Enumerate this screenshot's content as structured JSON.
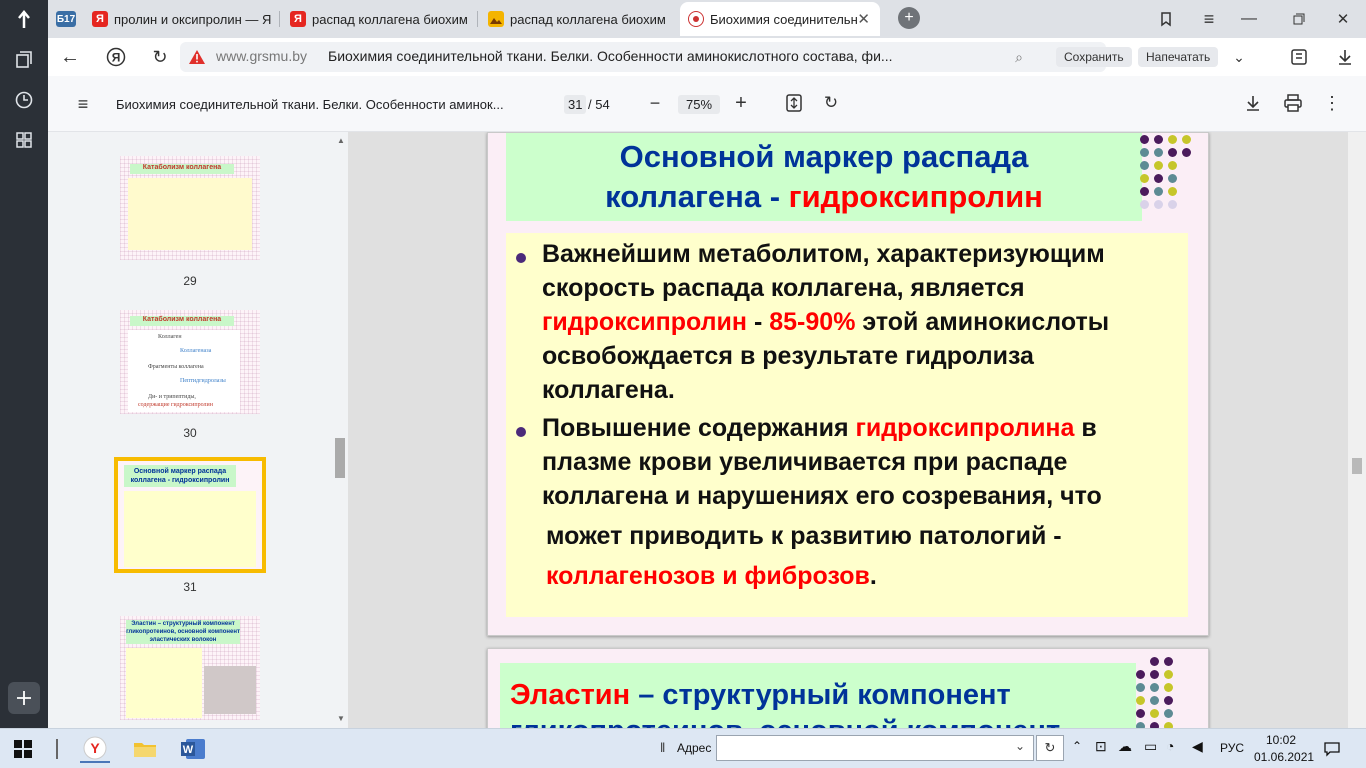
{
  "tabs": [
    {
      "label": "Б17",
      "kind": "pinned"
    },
    {
      "label": "пролин и оксипролин — Я",
      "icon": "yandex-icon"
    },
    {
      "label": "распад коллагена биохим",
      "icon": "yandex-icon"
    },
    {
      "label": "распад коллагена биохим",
      "icon": "image-icon"
    },
    {
      "label": "Биохимия соединительн",
      "icon": "site-icon",
      "active": true
    }
  ],
  "address": {
    "domain": "www.grsmu.by",
    "page_title": "Биохимия соединительной ткани. Белки. Особенности аминокислотного состава, фи...",
    "save_label": "Сохранить",
    "print_label": "Напечатать"
  },
  "pdf": {
    "doc_title": "Биохимия соединительной ткани. Белки. Особенности аминок...",
    "page_current": "31",
    "page_total": "/ 54",
    "zoom": "75%"
  },
  "thumbnails": [
    {
      "num": "29",
      "title": "Катаболизм коллагена"
    },
    {
      "num": "30",
      "title": "Катаболизм коллагена",
      "l1": "Коллаген",
      "l2": "Коллагеназа",
      "l3": "Фрагменты коллагена",
      "l4": "Пептидгидролазы",
      "l5": "Ди- и трипептиды,",
      "l6": "содержащие гидроксипролин"
    },
    {
      "num": "31",
      "title": "Основной маркер распада коллагена - гидроксипролин",
      "selected": true
    },
    {
      "num": "",
      "title": "Эластин – структурный компонент гликопротеинов, основной компонент эластических волокон"
    }
  ],
  "slide31": {
    "title_1": "Основной маркер распада",
    "title_2a": "коллагена - ",
    "title_2b": "гидроксипролин",
    "b1_l1": "Важнейшим метаболитом, характеризующим",
    "b1_l2": "скорость распада коллагена, является",
    "b1_l3a": "гидроксипролин",
    "b1_l3b": " - ",
    "b1_l3c": "85-90%",
    "b1_l3d": " этой аминокислоты",
    "b1_l4": "освобождается в результате гидролиза",
    "b1_l5": "коллагена.",
    "b2_l1a": "Повышение содержания ",
    "b2_l1b": "гидроксипролина",
    "b2_l1c": " в",
    "b2_l2": "плазме крови увеличивается при распаде",
    "b2_l3": "коллагена и нарушениях его созревания, что",
    "b2_l4": "может приводить к развитию патологий -",
    "b2_l5a": "коллагенозов и фиброзов",
    "b2_l5b": "."
  },
  "slide32": {
    "title_a": "Эластин",
    "title_b": " – структурный компонент",
    "title_c": "гликопротеинов, основной компонент"
  },
  "taskbar": {
    "address_label": "Адрес",
    "lang": "РУС",
    "time": "10:02",
    "date": "01.06.2021"
  }
}
